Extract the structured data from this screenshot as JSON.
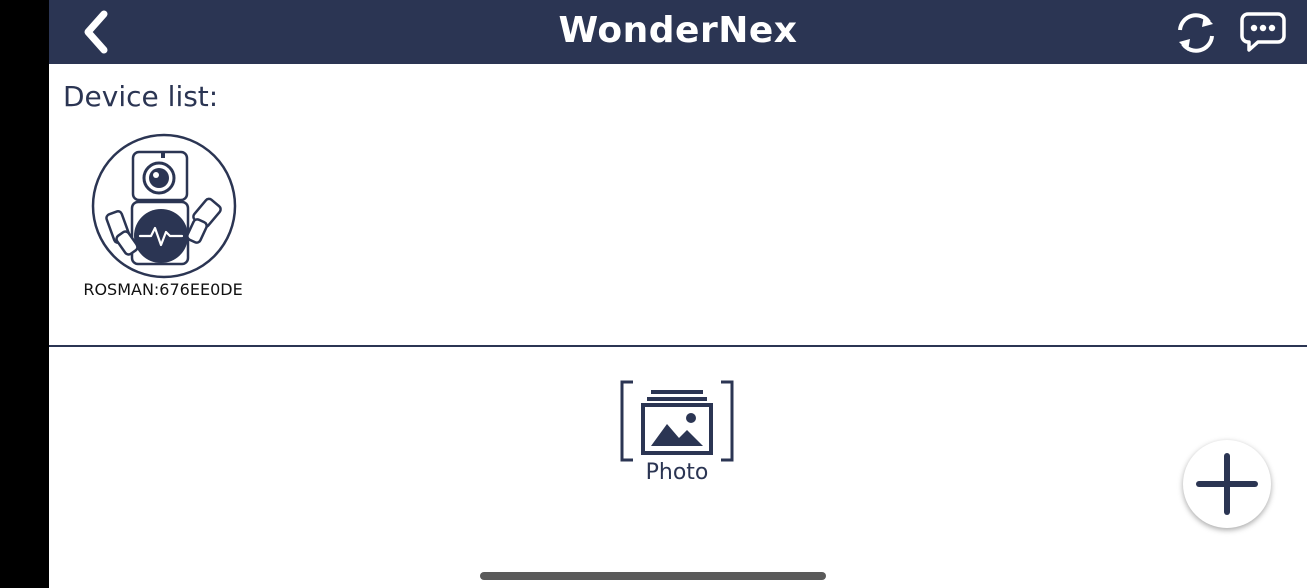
{
  "header": {
    "title": "WonderNex",
    "back_icon": "chevron-left-icon",
    "refresh_icon": "refresh-icon",
    "chat_icon": "chat-bubble-icon",
    "background_color": "#2b3553"
  },
  "devices": {
    "heading": "Device list:",
    "items": [
      {
        "name": "ROSMAN:676EE0DE",
        "icon": "robot-avatar-icon"
      }
    ]
  },
  "actions": {
    "photo_label": "Photo",
    "photo_icon": "photo-gallery-icon",
    "add_icon": "plus-icon"
  },
  "colors": {
    "accent": "#2b3553",
    "background": "#ffffff"
  }
}
